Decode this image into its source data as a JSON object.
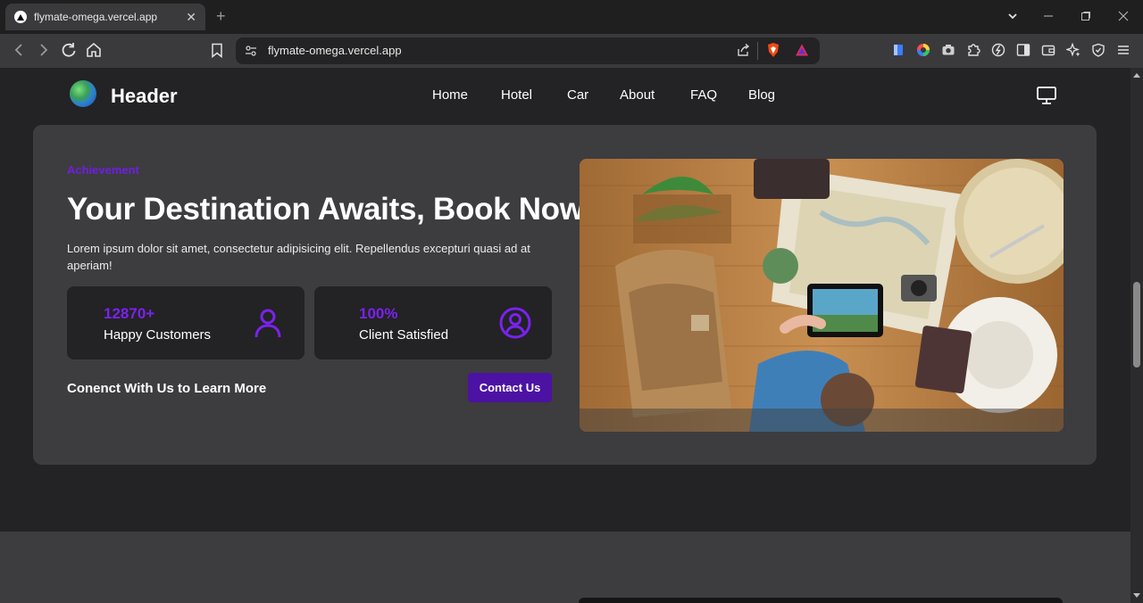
{
  "browser": {
    "tab_title": "flymate-omega.vercel.app",
    "tab_close": "✕",
    "new_tab": "+",
    "url": "flymate-omega.vercel.app"
  },
  "header": {
    "logo_text": "Header",
    "nav": [
      "Home",
      "Hotel",
      "Car",
      "About",
      "FAQ",
      "Blog"
    ]
  },
  "hero": {
    "eyebrow": "Achievement",
    "headline": "Your Destination Awaits, Book Now",
    "description": "Lorem ipsum dolor sit amet, consectetur adipisicing elit. Repellendus excepturi quasi ad at aperiam!",
    "stats": [
      {
        "number": "12870+",
        "label": "Happy Customers",
        "icon": "user-icon"
      },
      {
        "number": "100%",
        "label": "Client Satisfied",
        "icon": "user-circle-icon"
      }
    ],
    "connect_text": "Conenct With Us to Learn More",
    "contact_button": "Contact Us"
  },
  "colors": {
    "accent": "#7a22f0",
    "button": "#4c12a3",
    "card": "#3d3c3f",
    "background": "#232224"
  }
}
